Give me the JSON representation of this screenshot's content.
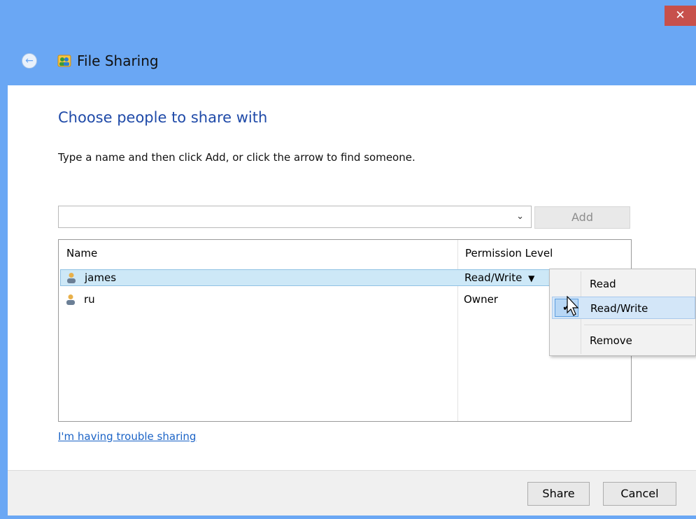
{
  "window": {
    "title": "File Sharing",
    "close_glyph": "✕",
    "back_glyph": "←",
    "icon": "file-sharing-icon"
  },
  "main": {
    "heading": "Choose people to share with",
    "instruction": "Type a name and then click Add, or click the arrow to find someone.",
    "name_input": {
      "value": "",
      "placeholder": ""
    },
    "dropdown_glyph": "⌄",
    "add_label": "Add"
  },
  "list": {
    "columns": {
      "name": "Name",
      "permission": "Permission Level"
    },
    "rows": [
      {
        "name": "james",
        "permission": "Read/Write",
        "permission_arrow": "▼",
        "selected": true
      },
      {
        "name": "ru",
        "permission": "Owner",
        "selected": false
      }
    ]
  },
  "trouble_link": "I'm having trouble sharing",
  "footer": {
    "share_label": "Share",
    "cancel_label": "Cancel"
  },
  "permission_menu": {
    "items": [
      {
        "label": "Read"
      },
      {
        "label": "Read/Write",
        "checked": true,
        "check_glyph": "✔"
      },
      {
        "label": "Remove"
      }
    ]
  },
  "colors": {
    "titlebar": "#6aa7f4",
    "heading": "#1f4aa8",
    "link": "#1b63c6",
    "selection": "#cde8f7",
    "close_button": "#c7504b"
  }
}
